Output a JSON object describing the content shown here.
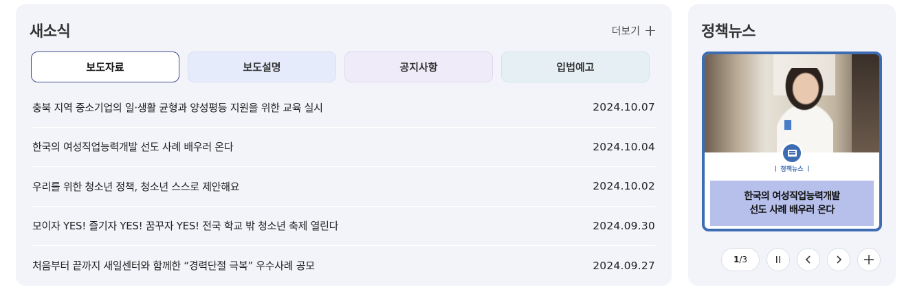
{
  "news": {
    "title": "새소식",
    "more_label": "더보기",
    "tabs": [
      {
        "label": "보도자료",
        "active": true
      },
      {
        "label": "보도설명",
        "active": false
      },
      {
        "label": "공지사항",
        "active": false
      },
      {
        "label": "입법예고",
        "active": false
      }
    ],
    "items": [
      {
        "text": "충북 지역 중소기업의 일·생활 균형과 양성평등 지원을 위한 교육 실시",
        "date": "2024.10.07"
      },
      {
        "text": "한국의 여성직업능력개발 선도 사례 배우러 온다",
        "date": "2024.10.04"
      },
      {
        "text": "우리를 위한 청소년 정책, 청소년 스스로 제안해요",
        "date": "2024.10.02"
      },
      {
        "text": "모이자 YES! 즐기자 YES! 꿈꾸자 YES! 전국 학교 밖 청소년 축제 열린다",
        "date": "2024.09.30"
      },
      {
        "text": "처음부터 끝까지 새일센터와 함께한 “경력단절 극복” 우수사례 공모",
        "date": "2024.09.27"
      }
    ]
  },
  "policy": {
    "title": "정책뉴스",
    "card": {
      "caption": "ㅣ 정책뉴스 ㅣ",
      "headline_line1": "한국의 여성직업능력개발",
      "headline_line2": "선도 사례 배우러 온다"
    },
    "pager": {
      "current": "1",
      "separator": "/",
      "total": "3"
    }
  },
  "colors": {
    "panel_bg": "#f2f4f9",
    "active_tab_border": "#3e4a8c",
    "card_border": "#3e6cb3",
    "headline_bg": "#b7bfeb"
  }
}
